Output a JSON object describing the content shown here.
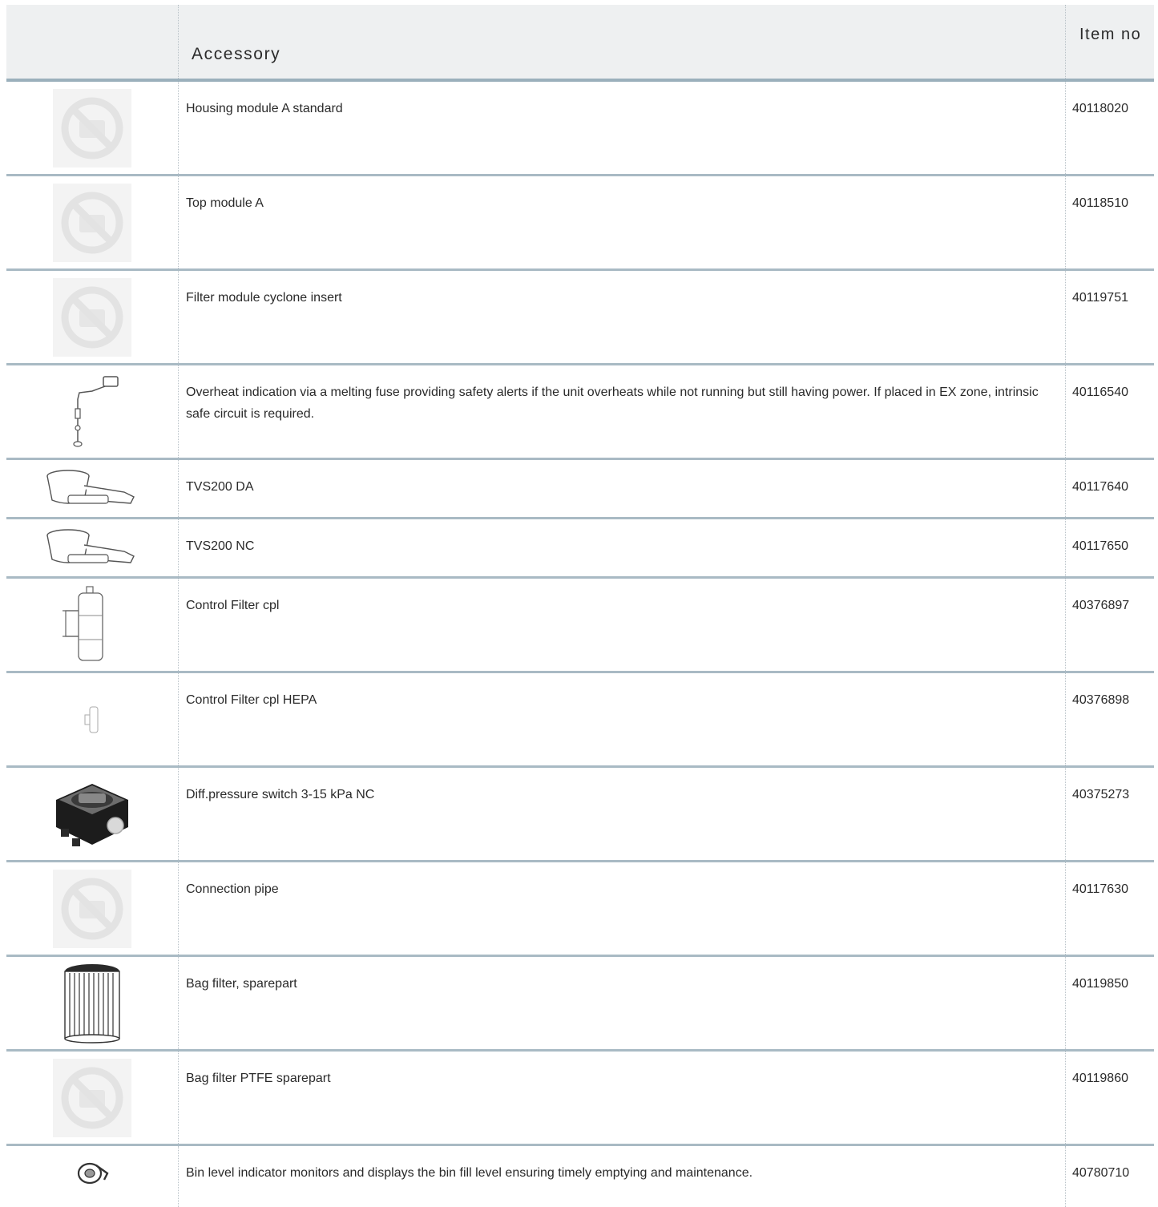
{
  "header": {
    "accessory_label": "Accessory",
    "item_no_label": "Item no"
  },
  "rows": [
    {
      "image": "no-image-icon",
      "description": "Housing module A standard",
      "item_no": "40118020"
    },
    {
      "image": "no-image-icon",
      "description": "Top module A",
      "item_no": "40118510"
    },
    {
      "image": "no-image-icon",
      "description": "Filter module cyclone insert",
      "item_no": "40119751"
    },
    {
      "image": "overheat-fuse-icon",
      "description": "Overheat indication via a melting fuse providing safety alerts if the unit overheats while not running but still having power. If placed in EX zone, intrinsic safe circuit is required.",
      "item_no": "40116540"
    },
    {
      "image": "damper-valve-icon",
      "description": "TVS200 DA",
      "item_no": "40117640"
    },
    {
      "image": "damper-valve-icon",
      "description": "TVS200 NC",
      "item_no": "40117650"
    },
    {
      "image": "control-filter-icon",
      "description": "Control Filter cpl",
      "item_no": "40376897"
    },
    {
      "image": "control-filter-small-icon",
      "description": "Control Filter cpl HEPA",
      "item_no": "40376898"
    },
    {
      "image": "pressure-switch-icon",
      "description": "Diff.pressure switch 3-15 kPa NC",
      "item_no": "40375273"
    },
    {
      "image": "no-image-icon",
      "description": "Connection pipe",
      "item_no": "40117630"
    },
    {
      "image": "bag-filter-icon",
      "description": "Bag filter, sparepart",
      "item_no": "40119850"
    },
    {
      "image": "no-image-icon",
      "description": "Bag filter PTFE sparepart",
      "item_no": "40119860"
    },
    {
      "image": "bin-level-indicator-icon",
      "description": "Bin level indicator monitors and displays the bin fill level ensuring timely emptying and maintenance.",
      "item_no": "40780710"
    }
  ]
}
